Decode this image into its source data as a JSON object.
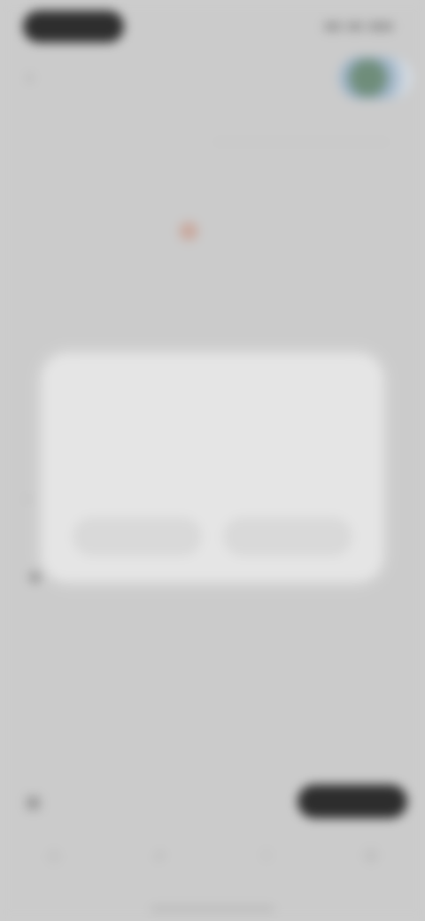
{
  "status_bar": {
    "time": "",
    "icons": [
      "signal-icon",
      "wifi-icon",
      "battery-icon"
    ]
  },
  "top_nav": {
    "title": "",
    "back_icon": "chevron-left-icon",
    "avatar_icon": "avatar"
  },
  "tabs": [
    "",
    ""
  ],
  "rows": [
    {
      "left": "",
      "right": ""
    },
    {
      "left": "",
      "right": ""
    },
    {
      "left": "",
      "right": ""
    },
    {
      "left": "",
      "right": ""
    }
  ],
  "dialog": {
    "title": "",
    "body": "",
    "secondary_button": "",
    "primary_button": ""
  },
  "bottom_row": {
    "text": "",
    "action_button": ""
  },
  "bottom_nav": [
    "home-icon",
    "search-icon",
    "bell-icon",
    "profile-icon"
  ],
  "colors": {
    "background": "#cbcbcb",
    "dialog": "#e5e5e5",
    "dark_pill": "#2d2d2d"
  }
}
